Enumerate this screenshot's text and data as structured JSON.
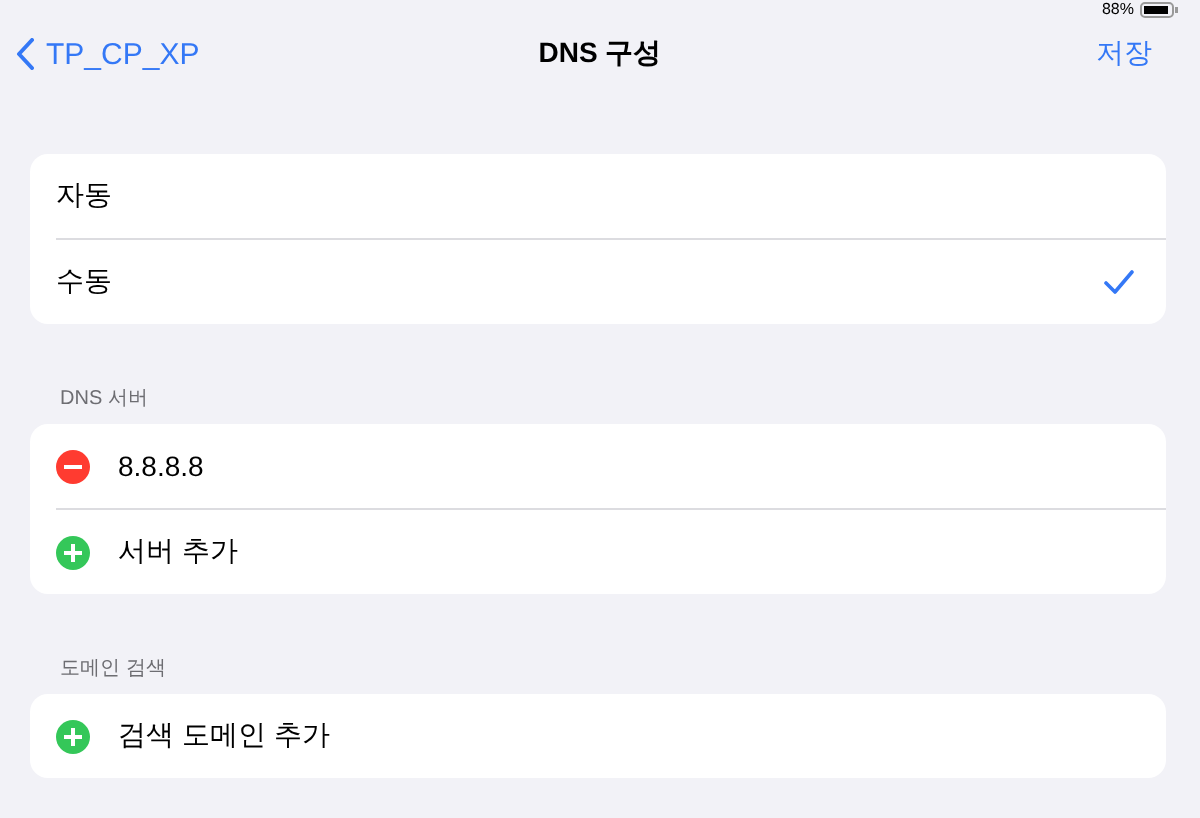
{
  "status_bar": {
    "battery_text": "88%"
  },
  "nav": {
    "back_label": "TP_CP_XP",
    "title": "DNS 구성",
    "action": "저장"
  },
  "mode_options": [
    {
      "label": "자동",
      "selected": false
    },
    {
      "label": "수동",
      "selected": true
    }
  ],
  "sections": [
    {
      "header": "DNS 서버",
      "rows": [
        {
          "kind": "remove",
          "label": "8.8.8.8"
        },
        {
          "kind": "add",
          "label": "서버 추가"
        }
      ]
    },
    {
      "header": "도메인 검색",
      "rows": [
        {
          "kind": "add",
          "label": "검색 도메인 추가"
        }
      ]
    }
  ]
}
